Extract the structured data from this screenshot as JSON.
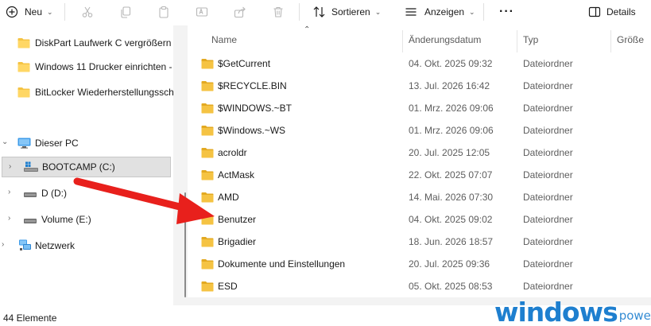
{
  "toolbar": {
    "new_label": "Neu",
    "sort_label": "Sortieren",
    "view_label": "Anzeigen",
    "details_label": "Details",
    "more_label": "···"
  },
  "nav": {
    "quick_access": [
      "DiskPart Laufwerk C vergrößern",
      "Windows 11 Drucker einrichten -",
      "BitLocker Wiederherstellungssch"
    ],
    "this_pc": "Dieser PC",
    "drives": [
      "BOOTCAMP (C:)",
      "D (D:)",
      "Volume (E:)"
    ],
    "network": "Netzwerk"
  },
  "columns": {
    "name": "Name",
    "date": "Änderungsdatum",
    "type": "Typ",
    "size": "Größe"
  },
  "files": [
    {
      "name": "$GetCurrent",
      "date": "04. Okt. 2025 09:32",
      "type": "Dateiordner"
    },
    {
      "name": "$RECYCLE.BIN",
      "date": "13. Jul. 2026 16:42",
      "type": "Dateiordner"
    },
    {
      "name": "$WINDOWS.~BT",
      "date": "01. Mrz. 2026 09:06",
      "type": "Dateiordner"
    },
    {
      "name": "$Windows.~WS",
      "date": "01. Mrz. 2026 09:06",
      "type": "Dateiordner"
    },
    {
      "name": "acroldr",
      "date": "20. Jul. 2025 12:05",
      "type": "Dateiordner"
    },
    {
      "name": "ActMask",
      "date": "22. Okt. 2025 07:07",
      "type": "Dateiordner"
    },
    {
      "name": "AMD",
      "date": "14. Mai. 2026 07:30",
      "type": "Dateiordner"
    },
    {
      "name": "Benutzer",
      "date": "04. Okt. 2025 09:02",
      "type": "Dateiordner"
    },
    {
      "name": "Brigadier",
      "date": "18. Jun. 2026 18:57",
      "type": "Dateiordner"
    },
    {
      "name": "Dokumente und Einstellungen",
      "date": "20. Jul. 2025 09:36",
      "type": "Dateiordner"
    },
    {
      "name": "ESD",
      "date": "05. Okt. 2025 08:53",
      "type": "Dateiordner"
    }
  ],
  "status": {
    "item_count": "44 Elemente"
  },
  "watermark": {
    "main": "windows",
    "sub": "power"
  },
  "colors": {
    "folder": "#f5c343",
    "folder_dark": "#e3a921",
    "arrow": "#e8201c",
    "watermark": "#1e7fcf",
    "selection": "#e1e1e1"
  }
}
